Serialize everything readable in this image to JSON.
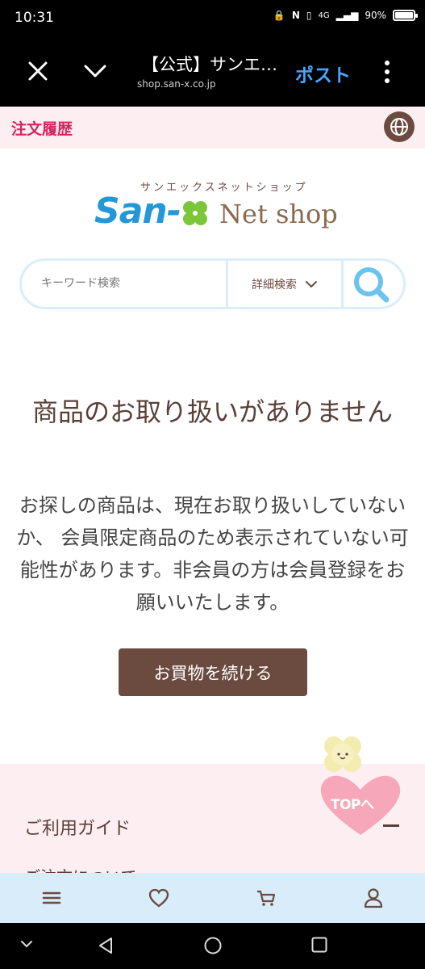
{
  "status_bar": {
    "time": "10:31",
    "network": "4G",
    "battery_pct": "90%",
    "battery_level": 0.9
  },
  "browser": {
    "title": "【公式】サンエ…",
    "url": "shop.san-x.co.jp",
    "post_label": "ポスト",
    "icons": [
      "close-icon",
      "chevron-down-icon",
      "kebab-menu-icon"
    ]
  },
  "order_bar": {
    "label": "注文履歴",
    "icon": "globe-icon"
  },
  "logo": {
    "kana": "サンエックスネットショップ",
    "brand": "San-",
    "suffix": "Net shop"
  },
  "search": {
    "placeholder": "キーワード検索",
    "detail_label": "詳細検索",
    "icon": "search-icon"
  },
  "message": {
    "heading": "商品のお取り扱いがありません",
    "body": "お探しの商品は、現在お取り扱いしていないか、 会員限定商品のため表示されていない可能性があります。非会員の方は会員登録をお願いいたします。",
    "button_label": "お買物を続ける"
  },
  "footer": {
    "guide_title": "ご利用ガイド",
    "guide_item": "ご注文について"
  },
  "top_button": {
    "label": "TOPへ"
  },
  "bottom_nav": {
    "items": [
      "menu-icon",
      "heart-icon",
      "cart-icon",
      "user-icon"
    ]
  },
  "system_nav": {
    "items": [
      "chevron-down-icon",
      "back-icon",
      "home-icon",
      "recents-icon"
    ]
  },
  "colors": {
    "brand_brown": "#6b4a3f",
    "accent_pink": "#d8245d",
    "brand_blue": "#2497d8",
    "clover_green": "#7cc63a"
  }
}
